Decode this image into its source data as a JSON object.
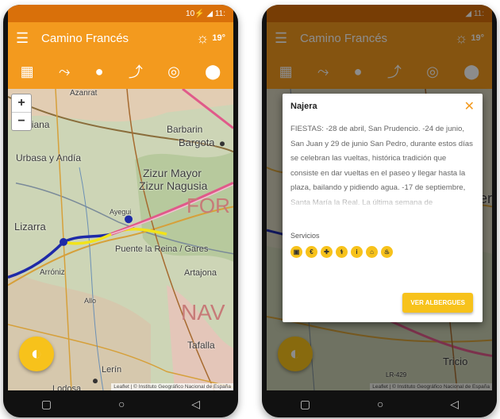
{
  "left": {
    "status_right": "10⚡ ◢ 11:",
    "app_title": "Camino Francés",
    "temperature": "19°",
    "map_labels": {
      "l1": "Azanrat",
      "l2": "Viana",
      "l3": "Barbarin",
      "l4": "Bargota",
      "l5": "Urbasa y Andía",
      "l6": "Zizur Mayor",
      "l7": "Zizur Nagusia",
      "l8": "Lizarra",
      "l9": "Puente la Reina / Gares",
      "l10": "Artajona",
      "l11": "Tafalla",
      "l12": "Lerín",
      "l13": "Lodosa",
      "l14": "NAV",
      "l15": "FOR",
      "l16": "Ayegui",
      "l17": "Arróniz",
      "l18": "Allo"
    },
    "attribution": "Leaflet | © Instituto Geográfico Nacional de España",
    "zoom_in": "+",
    "zoom_out": "−"
  },
  "right": {
    "status_right": "◢ 11:",
    "app_title": "Camino Francés",
    "temperature": "19°",
    "dialog": {
      "title": "Najera",
      "close": "✕",
      "text": "FIESTAS: -28 de abril, San Prudencio. -24 de junio, San Juan y 29 de junio San Pedro, durante estos días se celebran las vueltas, histórica tradición que consiste en dar vueltas en el paseo y llegar hasta la plaza, bailando y pidiendo agua. -17 de septiembre, Santa María la Real. La última semana de",
      "services_label": "Servicios",
      "button": "VER ALBERGUES"
    },
    "map_labels": {
      "r1": "Tricio",
      "r2": "er",
      "r3": "LR-429"
    },
    "attribution": "Leaflet | © Instituto Geográfico Nacional de España"
  },
  "colors": {
    "accent": "#f39a1e",
    "fab": "#f7c21b"
  }
}
